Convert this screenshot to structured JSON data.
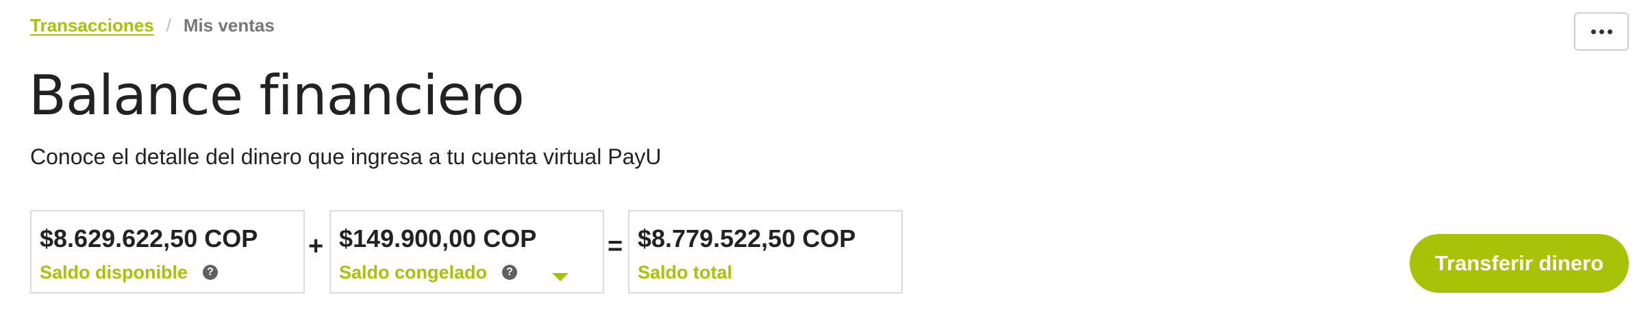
{
  "breadcrumb": {
    "link_label": "Transacciones",
    "separator": "/",
    "current_label": "Mis ventas"
  },
  "header": {
    "title": "Balance financiero",
    "subtitle": "Conoce el detalle del dinero que ingresa a tu cuenta virtual PayU",
    "more_icon": "more-horizontal-icon"
  },
  "balances": {
    "available": {
      "amount": "$8.629.622,50 COP",
      "label": "Saldo disponible",
      "help_icon": "?"
    },
    "plus_operator": "+",
    "frozen": {
      "amount": "$149.900,00 COP",
      "label": "Saldo congelado",
      "help_icon": "?",
      "expand_icon": "caret-down-icon"
    },
    "equals_operator": "=",
    "total": {
      "amount": "$8.779.522,50 COP",
      "label": "Saldo total"
    }
  },
  "actions": {
    "transfer_label": "Transferir dinero"
  },
  "colors": {
    "accent": "#a6c307",
    "text": "#222222",
    "muted": "#777777",
    "border": "#dcdcdc"
  }
}
